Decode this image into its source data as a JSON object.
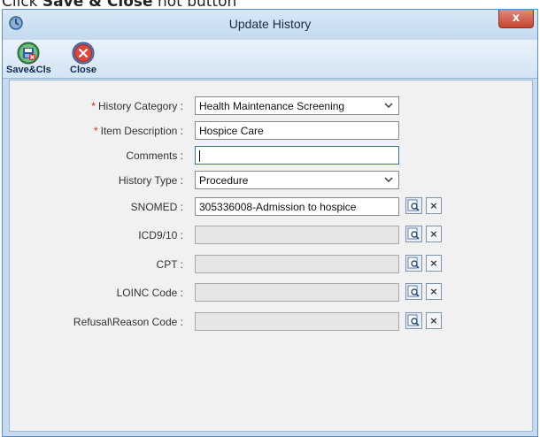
{
  "instruction": {
    "prefix": "Click ",
    "bold": "Save & Close",
    "suffix": " hot button"
  },
  "window": {
    "title": "Update History",
    "close_label": "x"
  },
  "toolbar": {
    "save_label": "Save&Cls",
    "close_label": "Close"
  },
  "form": {
    "history_category": {
      "label": "History Category :",
      "value": "Health Maintenance Screening"
    },
    "item_description": {
      "label": "Item Description :",
      "value": "Hospice Care"
    },
    "comments": {
      "label": "Comments :",
      "value": ""
    },
    "history_type": {
      "label": "History Type :",
      "value": "Procedure"
    },
    "snomed": {
      "label": "SNOMED :",
      "value": "305336008-Admission to hospice"
    },
    "icd": {
      "label": "ICD9/10 :",
      "value": ""
    },
    "cpt": {
      "label": "CPT :",
      "value": ""
    },
    "loinc": {
      "label": "LOINC Code :",
      "value": ""
    },
    "refusal": {
      "label": "Refusal\\Reason Code :",
      "value": ""
    }
  },
  "lookup_clear_label": "×"
}
